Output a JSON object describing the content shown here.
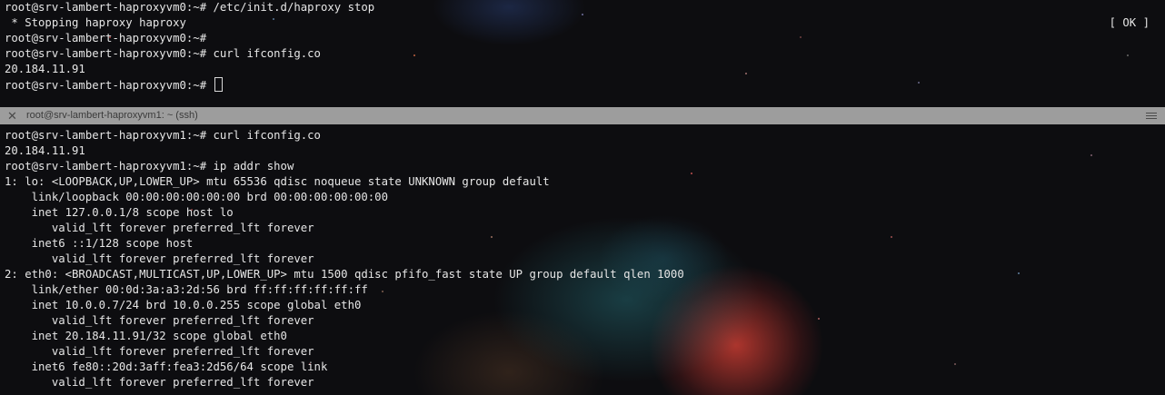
{
  "top_pane": {
    "lines": [
      "root@srv-lambert-haproxyvm0:~# /etc/init.d/haproxy stop",
      " * Stopping haproxy haproxy",
      "root@srv-lambert-haproxyvm0:~#",
      "root@srv-lambert-haproxyvm0:~# curl ifconfig.co",
      "20.184.11.91",
      "root@srv-lambert-haproxyvm0:~# "
    ],
    "status_ok": "[ OK ]"
  },
  "bottom_pane": {
    "title": "root@srv-lambert-haproxyvm1: ~ (ssh)",
    "lines": [
      "root@srv-lambert-haproxyvm1:~# curl ifconfig.co",
      "20.184.11.91",
      "root@srv-lambert-haproxyvm1:~# ip addr show",
      "1: lo: <LOOPBACK,UP,LOWER_UP> mtu 65536 qdisc noqueue state UNKNOWN group default",
      "    link/loopback 00:00:00:00:00:00 brd 00:00:00:00:00:00",
      "    inet 127.0.0.1/8 scope host lo",
      "       valid_lft forever preferred_lft forever",
      "    inet6 ::1/128 scope host",
      "       valid_lft forever preferred_lft forever",
      "2: eth0: <BROADCAST,MULTICAST,UP,LOWER_UP> mtu 1500 qdisc pfifo_fast state UP group default qlen 1000",
      "    link/ether 00:0d:3a:a3:2d:56 brd ff:ff:ff:ff:ff:ff",
      "    inet 10.0.0.7/24 brd 10.0.0.255 scope global eth0",
      "       valid_lft forever preferred_lft forever",
      "    inet 20.184.11.91/32 scope global eth0",
      "       valid_lft forever preferred_lft forever",
      "    inet6 fe80::20d:3aff:fea3:2d56/64 scope link",
      "       valid_lft forever preferred_lft forever"
    ]
  },
  "icons": {
    "close": "close-icon",
    "menu": "hamburger-menu-icon"
  },
  "colors": {
    "text": "#e6e6e6",
    "titlebar": "#9d9d9d",
    "background": "#0d0d10"
  }
}
